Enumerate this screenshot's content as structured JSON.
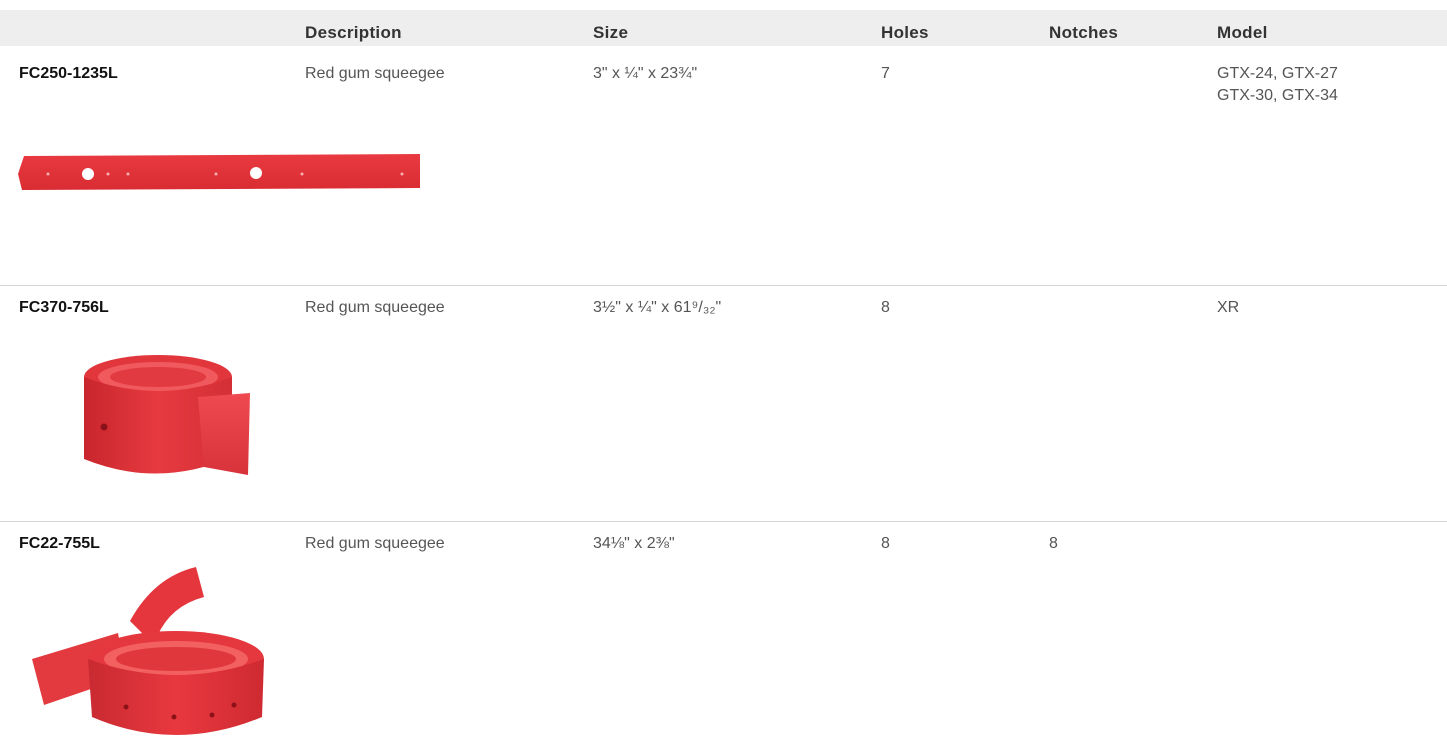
{
  "columns": {
    "description": "Description",
    "size": "Size",
    "holes": "Holes",
    "notches": "Notches",
    "model": "Model"
  },
  "rows": [
    {
      "part_number": "FC250-1235L",
      "description": "Red gum squeegee",
      "size": "3\" x ¼\" x 23¾\"",
      "holes": "7",
      "notches": "",
      "model": [
        "GTX-24, GTX-27",
        "GTX-30, GTX-34"
      ],
      "image": "red-squeegee-strip-image"
    },
    {
      "part_number": "FC370-756L",
      "description": "Red gum squeegee",
      "size": "3½\" x ¼\" x 61⁹/₃₂\"",
      "holes": "8",
      "notches": "",
      "model": [
        "XR"
      ],
      "image": "red-squeegee-roll-image"
    },
    {
      "part_number": "FC22-755L",
      "description": "Red gum squeegee",
      "size": "34⅛\" x 2⅜\"",
      "holes": "8",
      "notches": "8",
      "model": [],
      "image": "red-squeegee-coil-image"
    }
  ],
  "colors": {
    "header_bg": "#eeeeee",
    "divider": "#d6d6d6",
    "rubber_red": "#e8343b"
  }
}
